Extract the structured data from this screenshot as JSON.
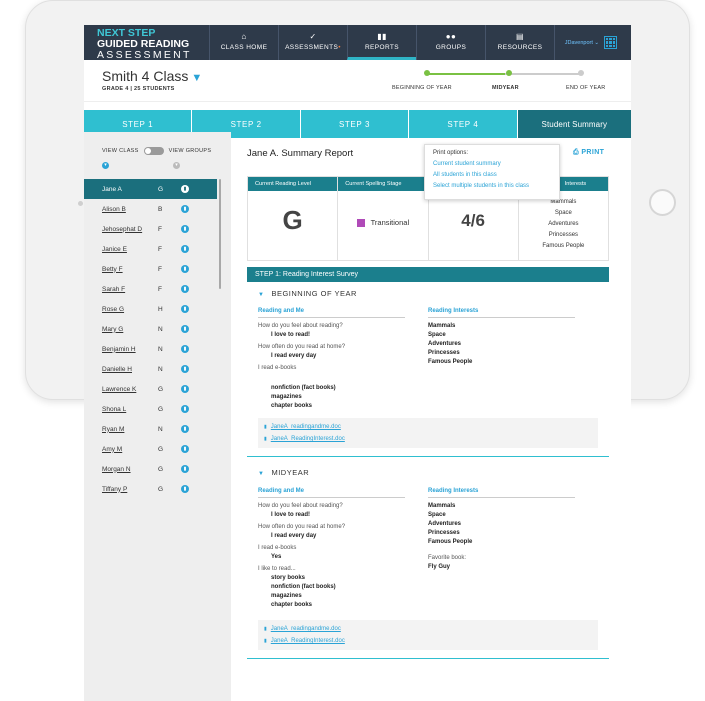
{
  "logo": {
    "line1": "NEXT STEP",
    "line2": "GUIDED READING",
    "line3": "ASSESSMENT"
  },
  "nav": [
    {
      "label": "CLASS HOME",
      "icon": "home-icon",
      "glyph": "⌂"
    },
    {
      "label": "ASSESSMENTS",
      "icon": "check-icon",
      "glyph": "✓"
    },
    {
      "label": "REPORTS",
      "icon": "bar-chart-icon",
      "glyph": "▮▮"
    },
    {
      "label": "GROUPS",
      "icon": "group-icon",
      "glyph": "●●"
    },
    {
      "label": "RESOURCES",
      "icon": "document-icon",
      "glyph": "▤"
    }
  ],
  "user": {
    "name": "JDavenport ⌄"
  },
  "class": {
    "name": "Smith 4 Class",
    "subinfo": "GRADE 4 | 25 STUDENTS"
  },
  "timeline": {
    "labels": [
      "BEGINNING OF YEAR",
      "MIDYEAR",
      "END OF YEAR"
    ],
    "progress": 0.5
  },
  "steps": [
    "STEP 1",
    "STEP 2",
    "STEP 3",
    "STEP 4",
    "Student Summary"
  ],
  "sidebar": {
    "view_class": "VIEW CLASS",
    "view_groups": "VIEW GROUPS",
    "students": [
      {
        "name": "Jane A",
        "level": "G",
        "selected": true
      },
      {
        "name": "Alison B",
        "level": "B"
      },
      {
        "name": "Jehosephat D",
        "level": "F"
      },
      {
        "name": "Janice E",
        "level": "F"
      },
      {
        "name": "Betty F",
        "level": "F"
      },
      {
        "name": "Sarah F",
        "level": "F"
      },
      {
        "name": "Rose G",
        "level": "H"
      },
      {
        "name": "Mary G",
        "level": "N"
      },
      {
        "name": "Benjamin H",
        "level": "N"
      },
      {
        "name": "Danielle H",
        "level": "N"
      },
      {
        "name": "Lawrence K",
        "level": "G"
      },
      {
        "name": "Shona L",
        "level": "G"
      },
      {
        "name": "Ryan M",
        "level": "N"
      },
      {
        "name": "Amy M",
        "level": "G"
      },
      {
        "name": "Morgan N",
        "level": "G"
      },
      {
        "name": "Tiffany P",
        "level": "G"
      }
    ]
  },
  "report": {
    "title": "Jane A. Summary Report",
    "print": "PRINT",
    "print_options": {
      "title": "Print options:",
      "options": [
        "Current student summary",
        "All students in this class",
        "Select multiple students in this class"
      ]
    },
    "cards": {
      "reading_level": {
        "header": "Current Reading Level",
        "value": "G"
      },
      "spelling": {
        "header": "Current Spelling Stage",
        "value": "Transitional",
        "color": "#b04ab8"
      },
      "score": {
        "header": "",
        "value": "4/6"
      },
      "interests": {
        "header": "Interests",
        "items": [
          "Mammals",
          "Space",
          "Adventures",
          "Princesses",
          "Famous People"
        ]
      }
    },
    "step1_header": "STEP 1: Reading Interest Survey",
    "beginning": {
      "title": "BEGINNING OF YEAR",
      "reading_and_me": "Reading and Me",
      "reading_interests": "Reading Interests",
      "q1": "How do you feel about reading?",
      "a1": "I love to read!",
      "q2": "How often do you read at home?",
      "a2": "I read every day",
      "q3": "I read e-books",
      "books": [
        "nonfiction (fact books)",
        "magazines",
        "chapter books"
      ],
      "interests": [
        "Mammals",
        "Space",
        "Adventures",
        "Princesses",
        "Famous People"
      ],
      "files": [
        "JaneA_readingandme.doc",
        "JaneA_ReadingInterest.doc"
      ]
    },
    "midyear": {
      "title": "MIDYEAR",
      "reading_and_me": "Reading and Me",
      "reading_interests": "Reading Interests",
      "q1": "How do you feel about reading?",
      "a1": "I love to read!",
      "q2": "How often do you read at home?",
      "a2": "I read every day",
      "q3": "I read e-books",
      "a3": "Yes",
      "q4": "I like to read...",
      "books": [
        "story books",
        "nonfiction (fact books)",
        "magazines",
        "chapter books"
      ],
      "interests": [
        "Mammals",
        "Space",
        "Adventures",
        "Princesses",
        "Famous People"
      ],
      "fav_label": "Favorite book:",
      "fav_value": "Fly Guy",
      "files": [
        "JaneA_readingandme.doc",
        "JaneA_ReadingInterest.doc"
      ]
    }
  }
}
